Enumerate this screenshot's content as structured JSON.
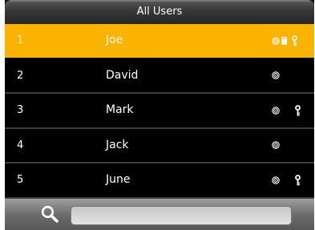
{
  "header": {
    "title": "All Users"
  },
  "users": [
    {
      "id": "1",
      "name": "Joe",
      "selected": true,
      "fingerprint": true,
      "card": true,
      "password": true
    },
    {
      "id": "2",
      "name": "David",
      "selected": false,
      "fingerprint": true,
      "card": false,
      "password": false
    },
    {
      "id": "3",
      "name": "Mark",
      "selected": false,
      "fingerprint": true,
      "card": false,
      "password": true
    },
    {
      "id": "4",
      "name": "Jack",
      "selected": false,
      "fingerprint": true,
      "card": false,
      "password": false
    },
    {
      "id": "5",
      "name": "June",
      "selected": false,
      "fingerprint": true,
      "card": false,
      "password": true
    }
  ],
  "search": {
    "icon": "search-icon",
    "value": ""
  },
  "colors": {
    "selected_row": "#f9b300",
    "background": "#000000",
    "text": "#ffffff"
  },
  "icons": {
    "fingerprint": "fingerprint-icon",
    "card": "card-icon",
    "password": "key-icon"
  }
}
